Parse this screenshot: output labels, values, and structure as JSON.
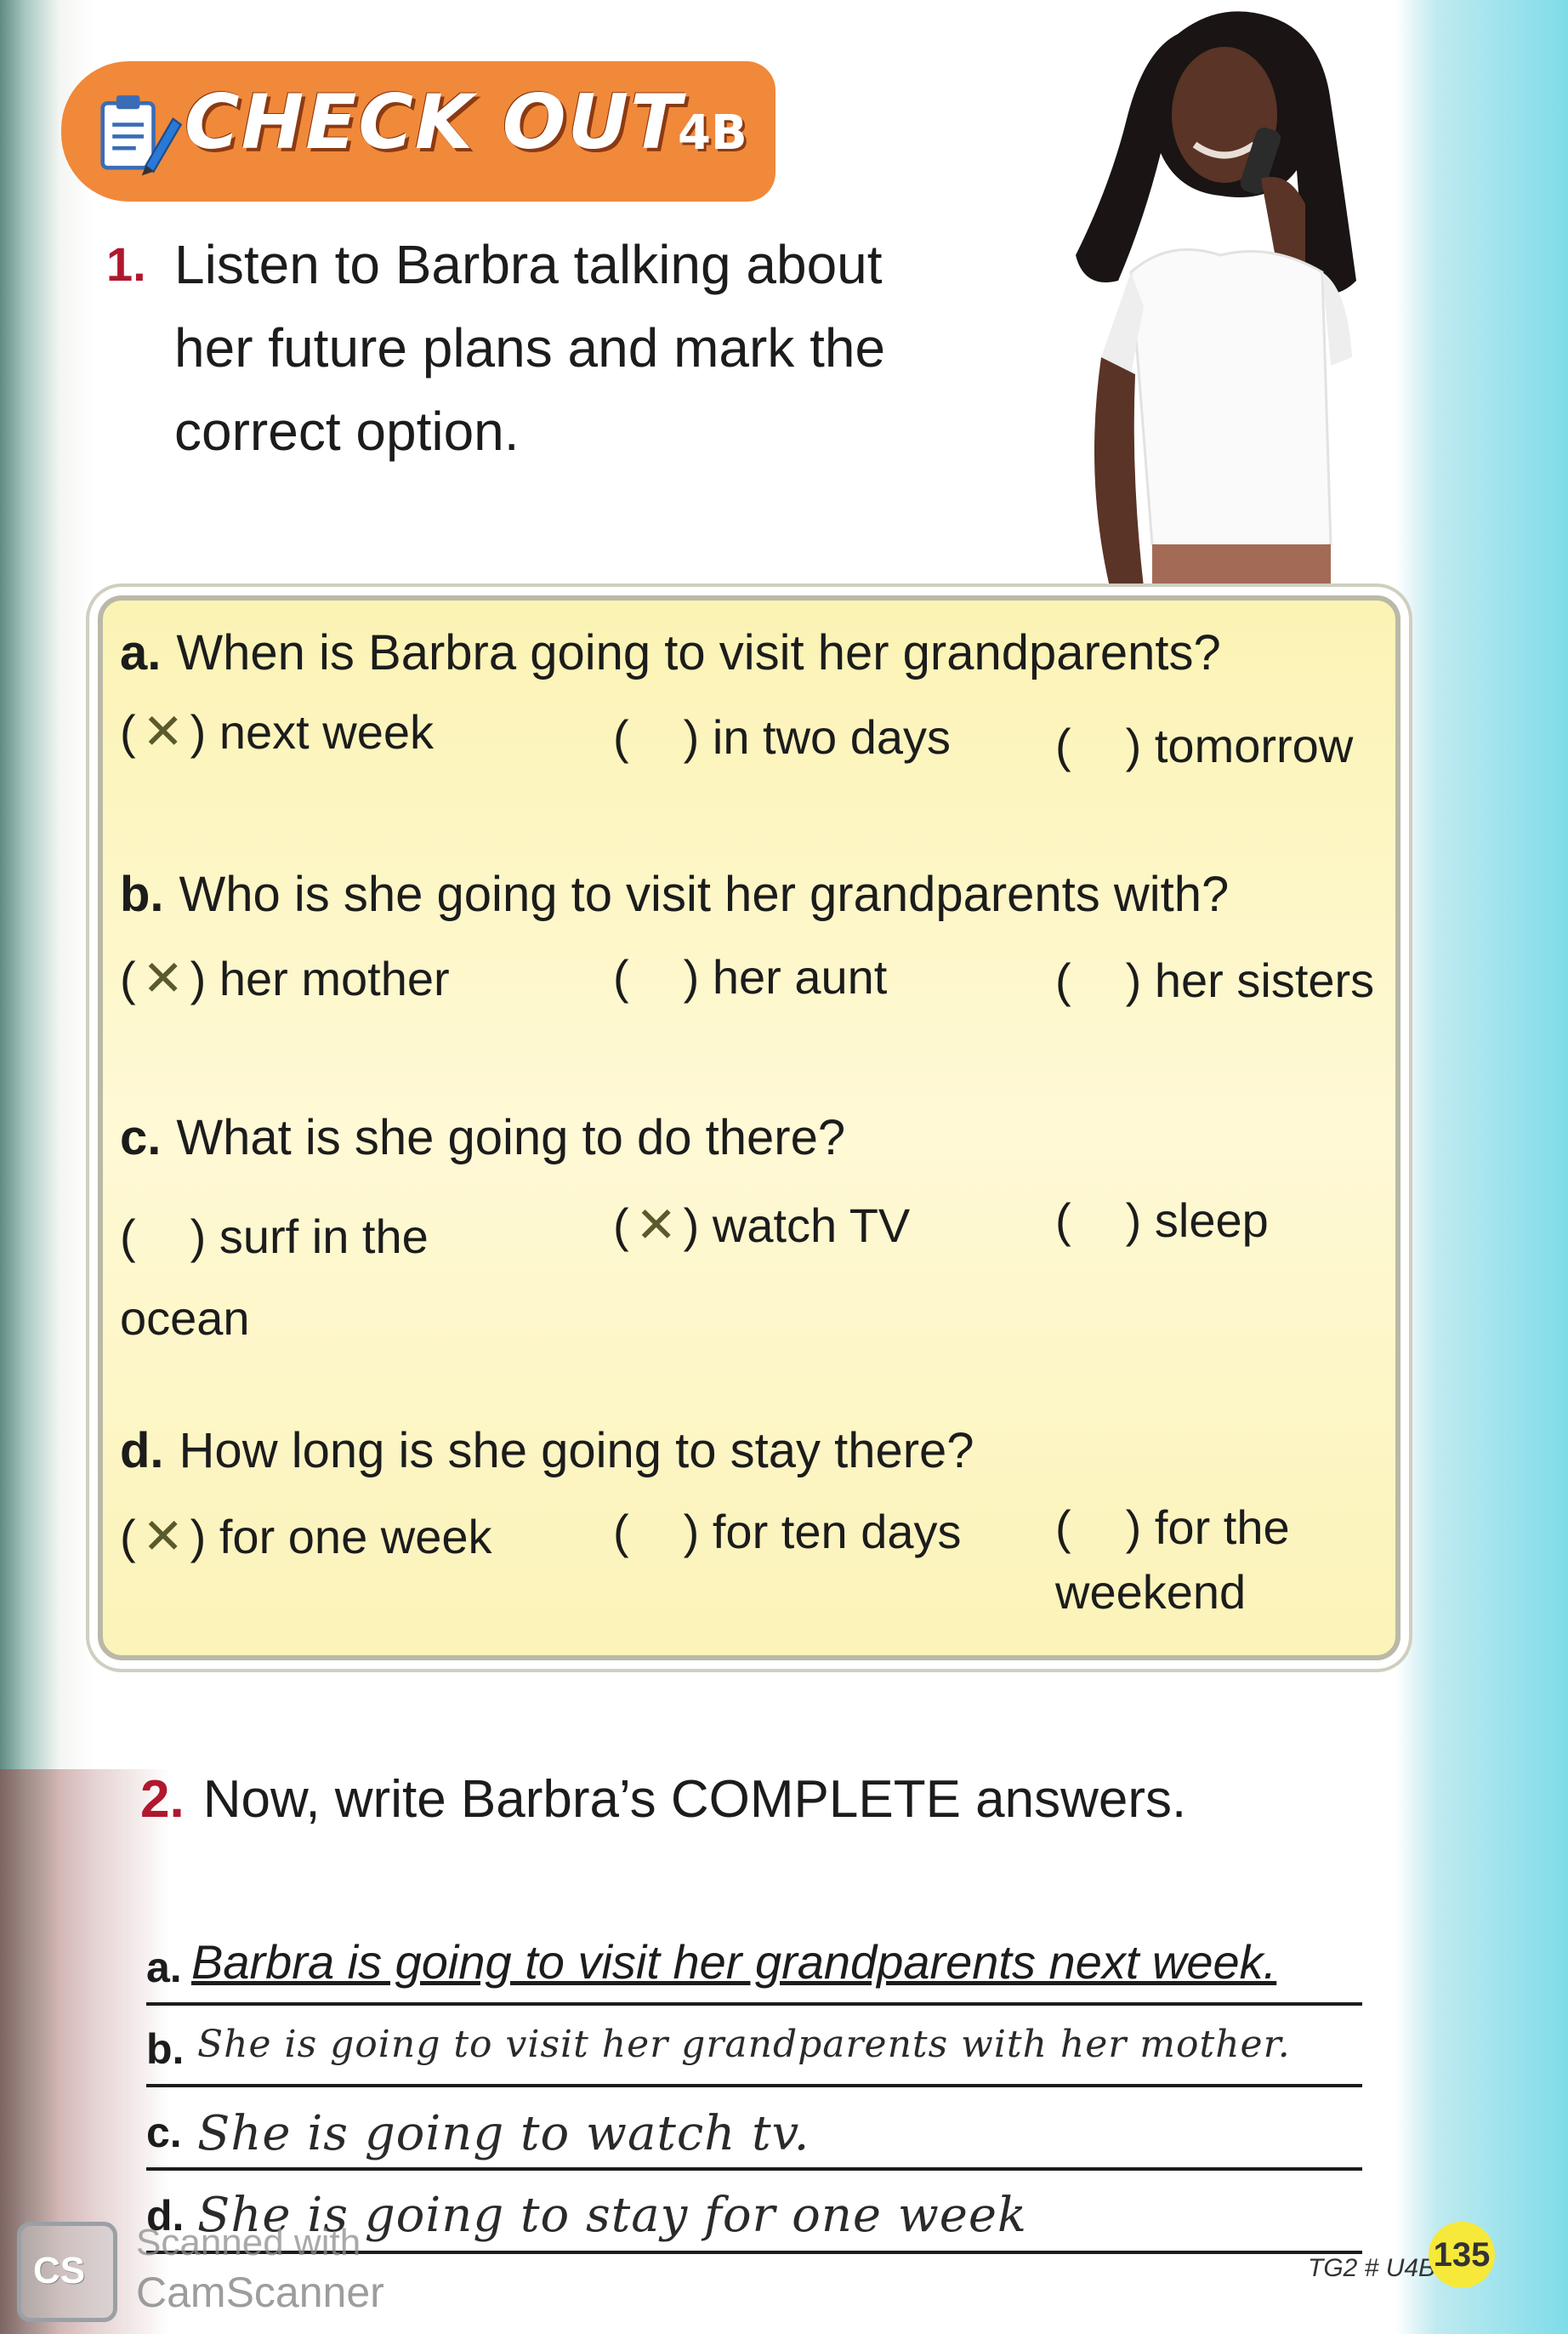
{
  "banner": {
    "title": "CHECK OUT",
    "code": "4B"
  },
  "exercise1": {
    "number": "1.",
    "instruction": "Listen to Barbra talking about her future plans and mark the correct option."
  },
  "questions": [
    {
      "label": "a.",
      "text": "When is Barbra going to visit her grandparents?",
      "options": [
        {
          "text": "next week",
          "marked": true
        },
        {
          "text": "in two days",
          "marked": false
        },
        {
          "text": "tomorrow",
          "marked": false
        }
      ]
    },
    {
      "label": "b.",
      "text": "Who is she going to visit her grandparents with?",
      "options": [
        {
          "text": "her mother",
          "marked": true
        },
        {
          "text": "her aunt",
          "marked": false
        },
        {
          "text": "her sisters",
          "marked": false
        }
      ]
    },
    {
      "label": "c.",
      "text": "What is she going to do there?",
      "options": [
        {
          "text": "surf in the ocean",
          "marked": false
        },
        {
          "text": "watch TV",
          "marked": true
        },
        {
          "text": "sleep",
          "marked": false
        }
      ]
    },
    {
      "label": "d.",
      "text": "How long is she going to stay there?",
      "options": [
        {
          "text": "for one week",
          "marked": true
        },
        {
          "text": "for ten days",
          "marked": false
        },
        {
          "text": "for the weekend",
          "marked": false
        }
      ]
    }
  ],
  "exercise2": {
    "number": "2.",
    "instruction": "Now, write Barbra’s COMPLETE answers.",
    "answers": [
      {
        "label": "a.",
        "text": "Barbra is going to visit her grandparents next week.",
        "style": "typed"
      },
      {
        "label": "b.",
        "text": "She is going to visit her grandparents with her mother.",
        "style": "handwritten"
      },
      {
        "label": "c.",
        "text": "She is going to watch tv.",
        "style": "handwritten"
      },
      {
        "label": "d.",
        "text": "She is going to stay for one week",
        "style": "handwritten"
      }
    ]
  },
  "footer": {
    "scanner_logo": "CS",
    "scanner_line1": "Scanned with",
    "scanner_line2": "CamScanner",
    "page_code": "TG2 # U4B",
    "page_number": "135"
  },
  "colors": {
    "banner": "#f0893a",
    "exercise_number": "#b0182e",
    "box_fill": "#fbf3b4",
    "page_badge": "#f7e93a"
  }
}
